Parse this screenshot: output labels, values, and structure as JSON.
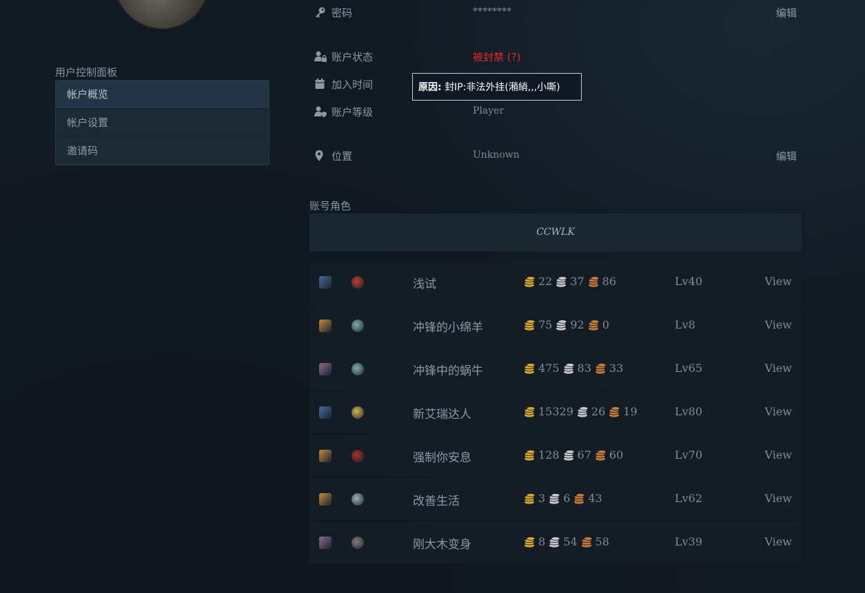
{
  "sidebar": {
    "title": "用户控制面板",
    "items": [
      {
        "label": "帐户概览",
        "active": true
      },
      {
        "label": "帐户设置",
        "active": false
      },
      {
        "label": "邀请码",
        "active": false
      }
    ]
  },
  "account": {
    "password": {
      "label": "密码",
      "value": "********",
      "edit": "编辑",
      "icon": "key-icon"
    },
    "status": {
      "label": "账户状态",
      "value": "被封禁 (?)",
      "icon": "user-lock-icon",
      "color": "#e02a2a"
    },
    "joined": {
      "label": "加入时间",
      "icon": "calendar-icon"
    },
    "level": {
      "label": "账户等级",
      "value": "Player",
      "icon": "user-shield-icon"
    },
    "location": {
      "label": "位置",
      "value": "Unknown",
      "edit": "编辑",
      "icon": "location-pin-icon"
    }
  },
  "tooltip": {
    "prefix": "原因:",
    "text": "封IP:非法外挂(潲綃,,,小嘶)"
  },
  "characters": {
    "title": "账号角色",
    "realm": "CCWLK",
    "view_label": "View",
    "rows": [
      {
        "name": "浅试",
        "gold": "22",
        "silver": "37",
        "copper": "86",
        "level": "Lv40",
        "race_color": "#4a6a9a",
        "class_color": "#c0392b"
      },
      {
        "name": "冲锋的小绵羊",
        "gold": "75",
        "silver": "92",
        "copper": "0",
        "level": "Lv8",
        "race_color": "#c98a3a",
        "class_color": "#7fb0a0"
      },
      {
        "name": "冲锋中的蜗牛",
        "gold": "475",
        "silver": "83",
        "copper": "33",
        "level": "Lv65",
        "race_color": "#8a6a8a",
        "class_color": "#7fb0a0"
      },
      {
        "name": "新艾瑞达人",
        "gold": "15329",
        "silver": "26",
        "copper": "19",
        "level": "Lv80",
        "race_color": "#4a6a9a",
        "class_color": "#d4b84a"
      },
      {
        "name": "强制你安息",
        "gold": "128",
        "silver": "67",
        "copper": "60",
        "level": "Lv70",
        "race_color": "#c98a3a",
        "class_color": "#b02a2a"
      },
      {
        "name": "改善生活",
        "gold": "3",
        "silver": "6",
        "copper": "43",
        "level": "Lv62",
        "race_color": "#c98a3a",
        "class_color": "#9ab0b8"
      },
      {
        "name": "刚大木变身",
        "gold": "8",
        "silver": "54",
        "copper": "58",
        "level": "Lv39",
        "race_color": "#8a6a8a",
        "class_color": "#8a7a7a"
      }
    ]
  },
  "colors": {
    "gold": "#d8a82a",
    "silver": "#c8c8c8",
    "copper": "#c57a3a"
  }
}
